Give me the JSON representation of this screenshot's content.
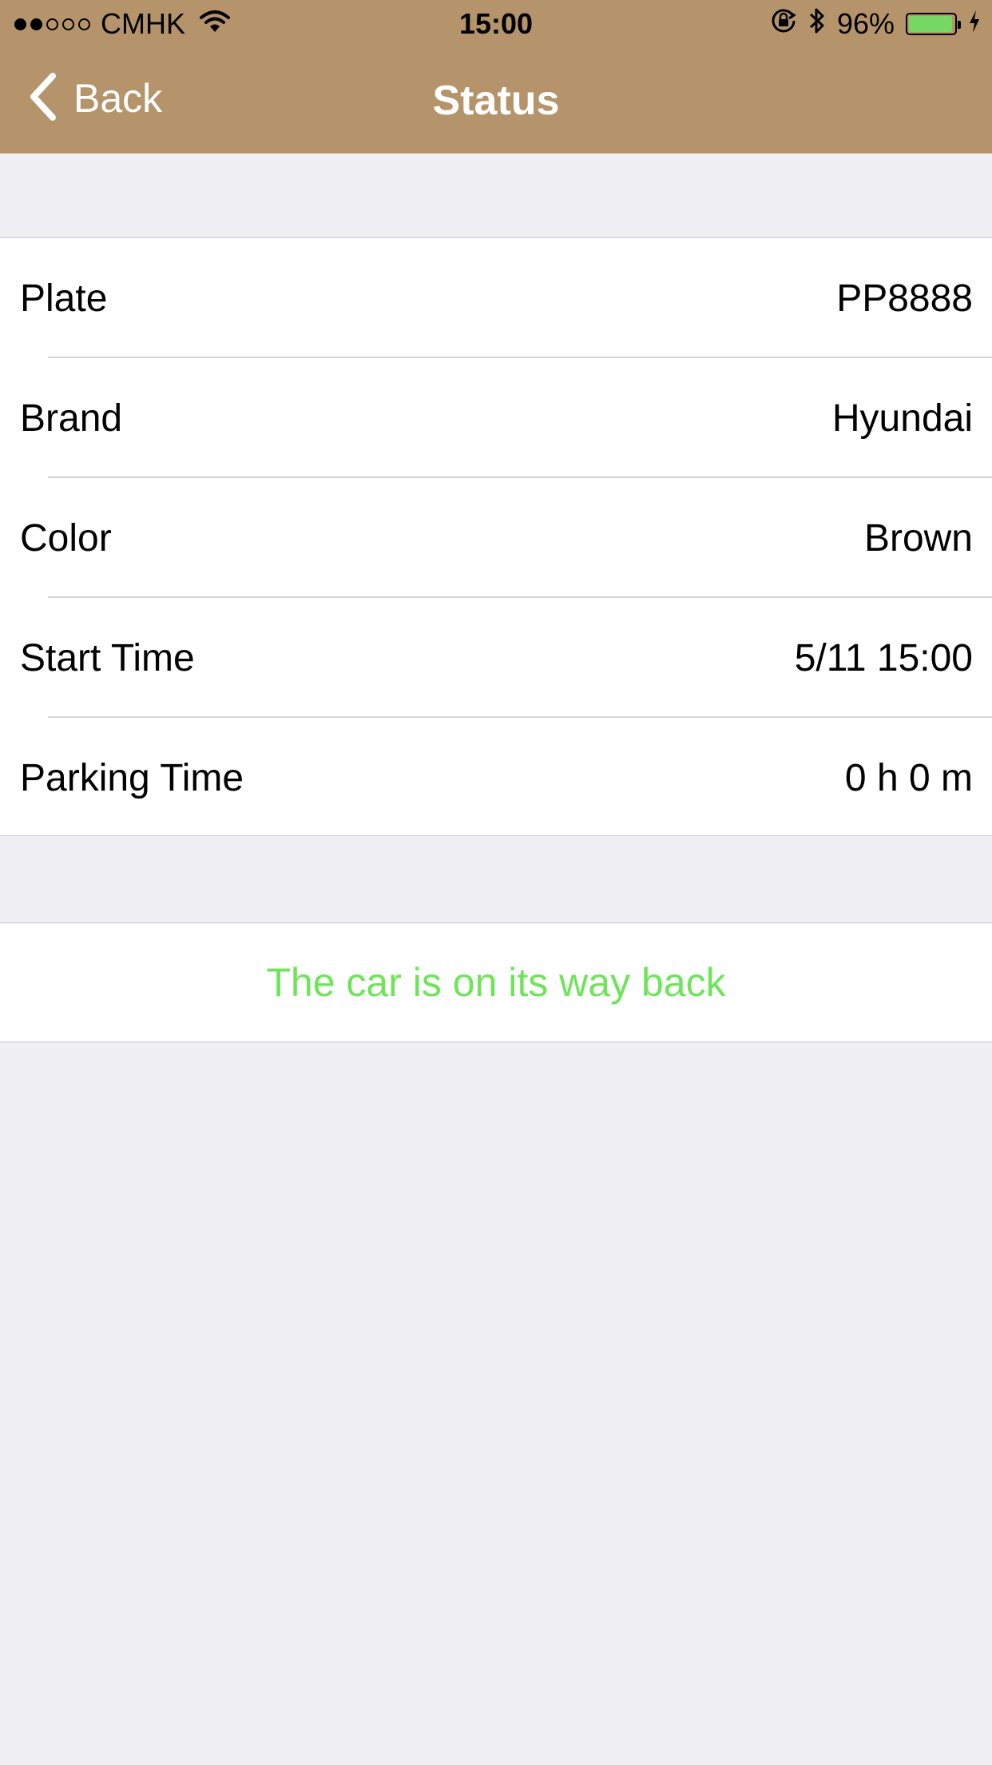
{
  "status_bar": {
    "signal_filled": 2,
    "signal_total": 5,
    "carrier": "CMHK",
    "time": "15:00",
    "battery_percent": "96%",
    "battery_level": 0.96,
    "battery_color": "#78d864"
  },
  "nav": {
    "back_label": "Back",
    "title": "Status",
    "background_color": "#b5946b"
  },
  "details": [
    {
      "label": "Plate",
      "value": "PP8888"
    },
    {
      "label": "Brand",
      "value": "Hyundai"
    },
    {
      "label": "Color",
      "value": "Brown"
    },
    {
      "label": "Start Time",
      "value": "5/11 15:00"
    },
    {
      "label": "Parking Time",
      "value": "0 h 0 m"
    }
  ],
  "status": {
    "message": "The car is on its way back",
    "color": "#6fe45a"
  }
}
